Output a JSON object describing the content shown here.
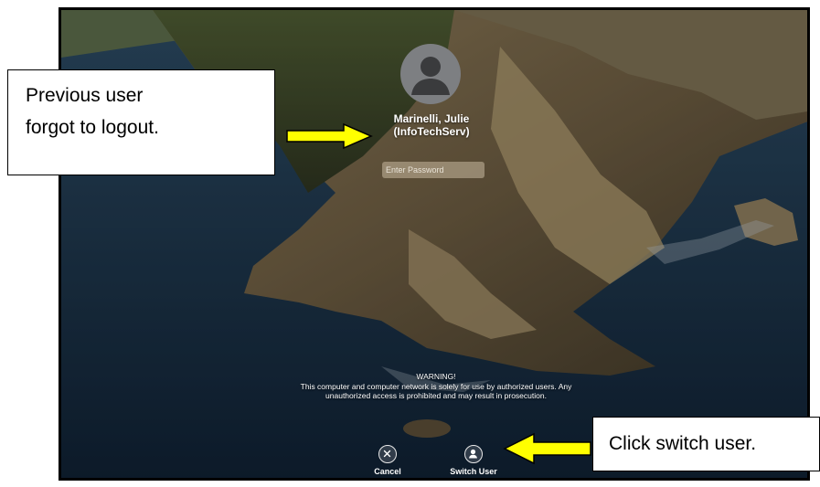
{
  "login_screen": {
    "user_name_line1": "Marinelli, Julie",
    "user_name_line2": "(InfoTechServ)",
    "password_placeholder": "Enter Password",
    "warning_title": "WARNING!",
    "warning_line1": "This computer and computer network is solely for use by authorized users. Any",
    "warning_line2": "unauthorized access is prohibited and may result in prosecution.",
    "cancel_label": "Cancel",
    "switch_user_label": "Switch User"
  },
  "annotations": {
    "callout_1_line1": "Previous user",
    "callout_1_line2": "forgot to logout.",
    "callout_2": "Click switch user.",
    "arrow_color": "#ffff00"
  },
  "icons": {
    "avatar": "person-silhouette-icon",
    "cancel": "x-circle-icon",
    "switch_user": "person-circle-icon"
  }
}
